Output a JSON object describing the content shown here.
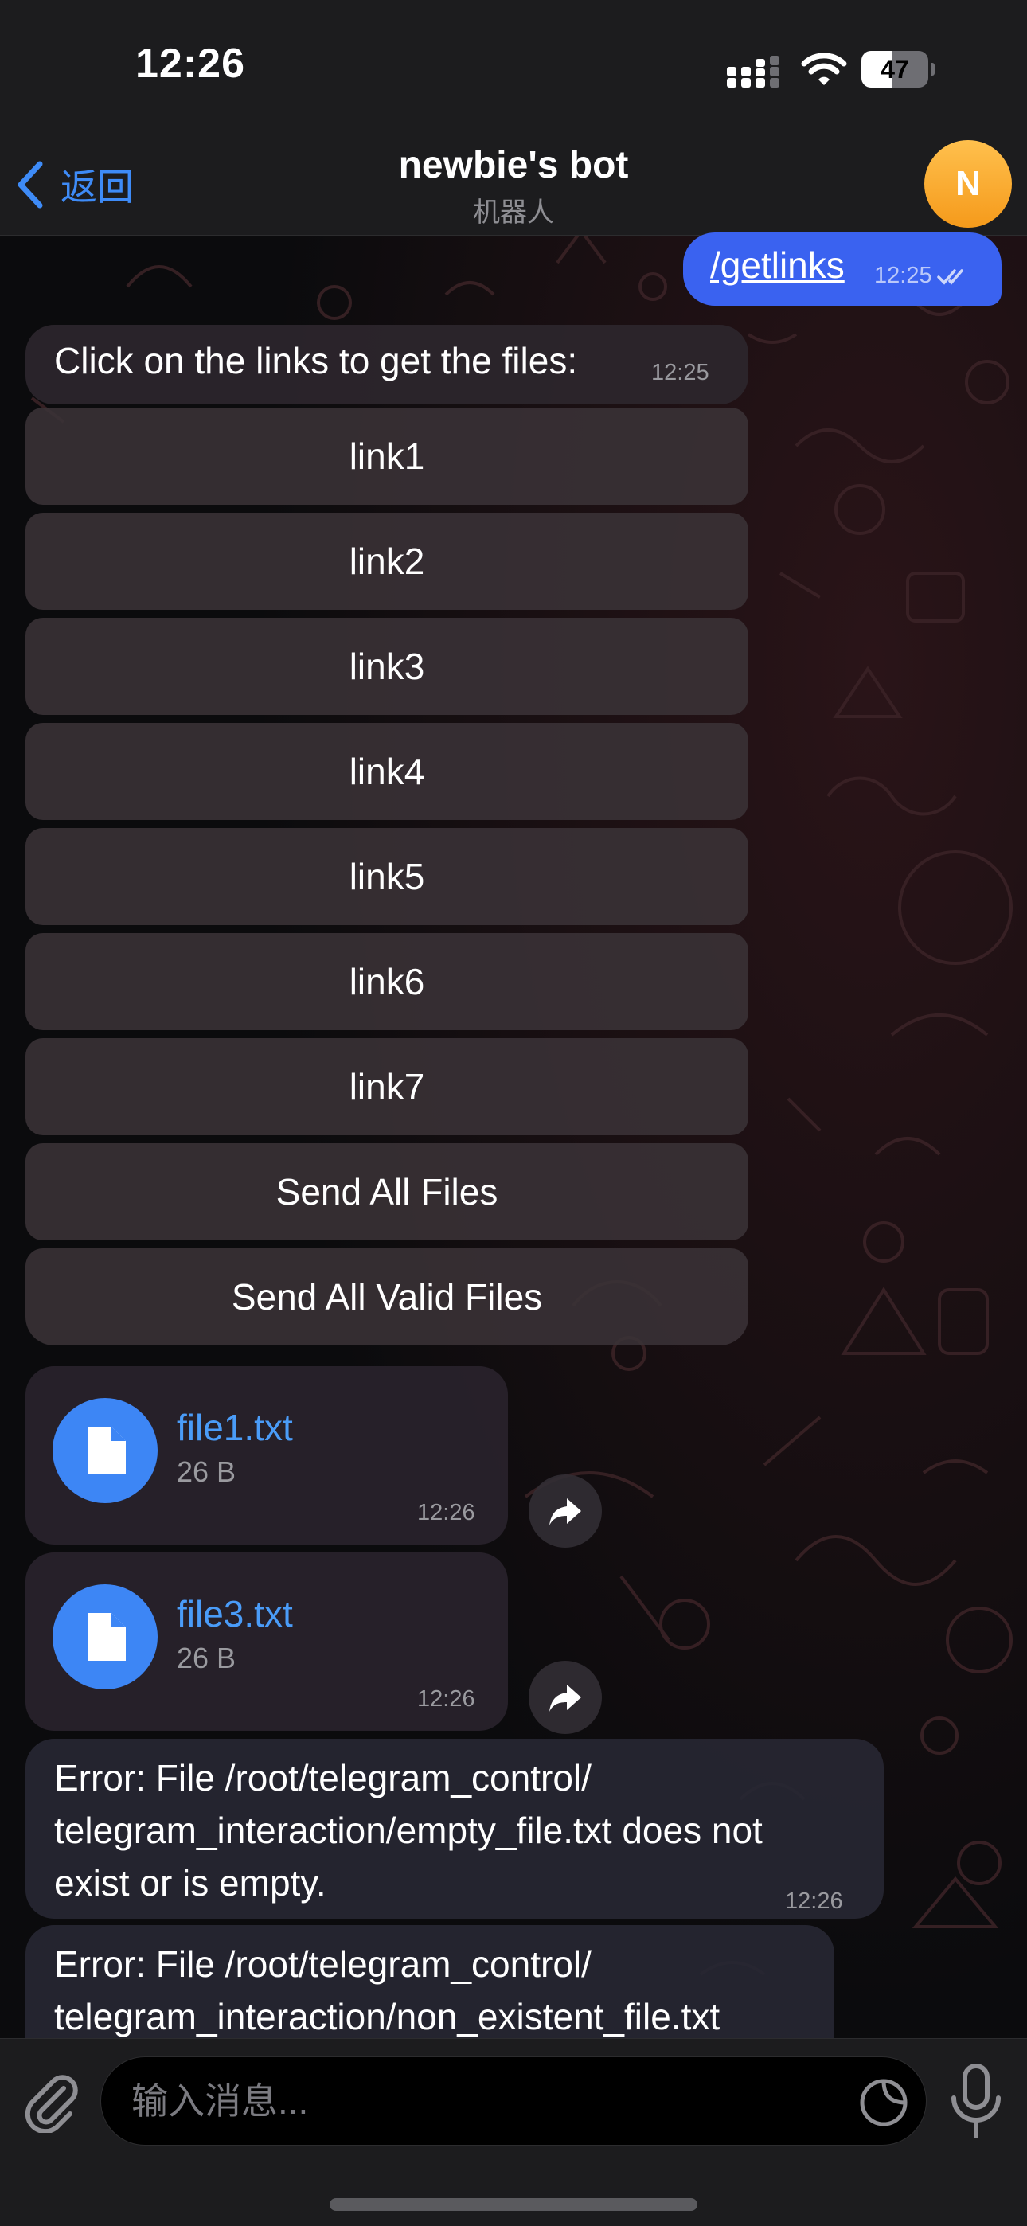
{
  "status_bar": {
    "time": "12:26",
    "battery_level": "47",
    "battery_fraction": 0.47
  },
  "header": {
    "back_label": "返回",
    "title": "newbie's bot",
    "subtitle": "机器人",
    "avatar_initial": "N",
    "avatar_color": "#f7a52b"
  },
  "messages": {
    "outgoing": {
      "text": "/getlinks",
      "time": "12:25",
      "status_icon": "double-check-icon"
    },
    "bot_prompt": {
      "text": "Click on the links to get the files:",
      "time": "12:25"
    },
    "keyboard_buttons": [
      "link1",
      "link2",
      "link3",
      "link4",
      "link5",
      "link6",
      "link7",
      "Send All Files",
      "Send All Valid Files"
    ],
    "files": [
      {
        "name": "file1.txt",
        "size": "26 B",
        "time": "12:26"
      },
      {
        "name": "file3.txt",
        "size": "26 B",
        "time": "12:26"
      }
    ],
    "errors": [
      {
        "text": "Error: File /root/telegram_control/\ntelegram_interaction/empty_file.txt does not\nexist or is empty.",
        "time": "12:26"
      },
      {
        "text": "Error: File /root/telegram_control/\ntelegram_interaction/non_existent_file.txt"
      }
    ]
  },
  "input": {
    "placeholder": "输入消息..."
  },
  "colors": {
    "accent": "#3e8bf7",
    "outgoing_bubble": "#3a62f0",
    "file_link": "#4a9cf8"
  }
}
